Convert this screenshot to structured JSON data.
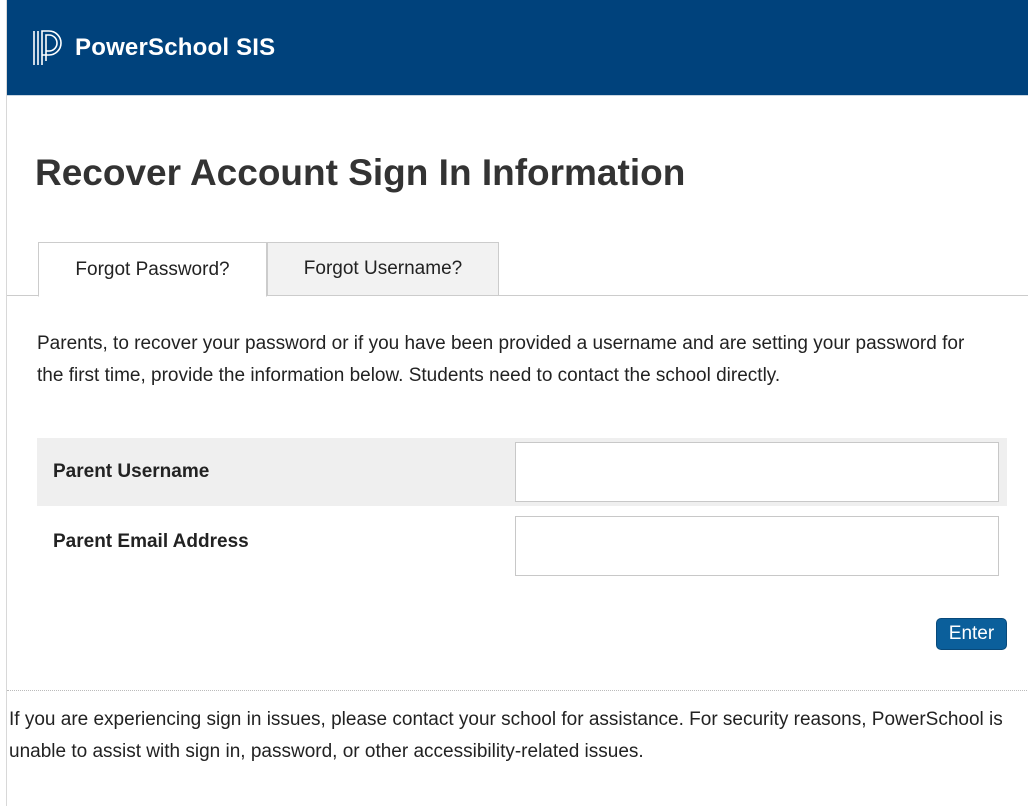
{
  "header": {
    "logo_text": "PowerSchool SIS",
    "brand_color": "#00427c",
    "logo_icon": "powerschool-logo-icon"
  },
  "page": {
    "title": "Recover Account Sign In Information"
  },
  "tabs": [
    {
      "label": "Forgot Password?",
      "active": true
    },
    {
      "label": "Forgot Username?",
      "active": false
    }
  ],
  "form": {
    "intro": "Parents, to recover your password or if you have been provided a username and are setting your password for the first time, provide the information below. Students need to contact the school directly.",
    "fields": [
      {
        "label": "Parent Username",
        "value": "",
        "placeholder": ""
      },
      {
        "label": "Parent Email Address",
        "value": "",
        "placeholder": ""
      }
    ],
    "submit_label": "Enter",
    "submit_color": "#0b5f9b"
  },
  "footer": {
    "text": "If you are experiencing sign in issues, please contact your school for assistance. For security reasons, PowerSchool is unable to assist with sign in, password, or other accessibility-related issues."
  }
}
